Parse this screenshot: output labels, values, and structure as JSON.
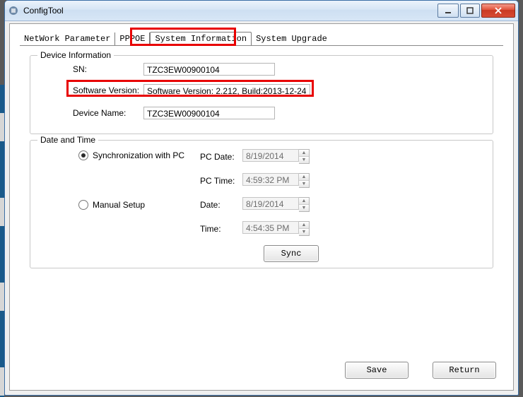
{
  "window": {
    "title": "ConfigTool"
  },
  "tabs": {
    "network": "NetWork Parameter",
    "pppoe": "PPPOE",
    "sysinfo": "System Information",
    "upgrade": "System Upgrade"
  },
  "device_info": {
    "legend": "Device Information",
    "sn_label": "SN:",
    "sn_value": "TZC3EW00900104",
    "sw_label": "Software Version:",
    "sw_value": "Software Version: 2.212, Build:2013-12-24",
    "name_label": "Device Name:",
    "name_value": "TZC3EW00900104"
  },
  "datetime": {
    "legend": "Date and Time",
    "sync_label": "Synchronization with PC",
    "manual_label": "Manual Setup",
    "pc_date_label": "PC Date:",
    "pc_date_value": "8/19/2014",
    "pc_time_label": "PC Time:",
    "pc_time_value": "4:59:32 PM",
    "date_label": "Date:",
    "date_value": "8/19/2014",
    "time_label": "Time:",
    "time_value": "4:54:35 PM",
    "sync_btn": "Sync"
  },
  "footer": {
    "save": "Save",
    "return": "Return"
  }
}
